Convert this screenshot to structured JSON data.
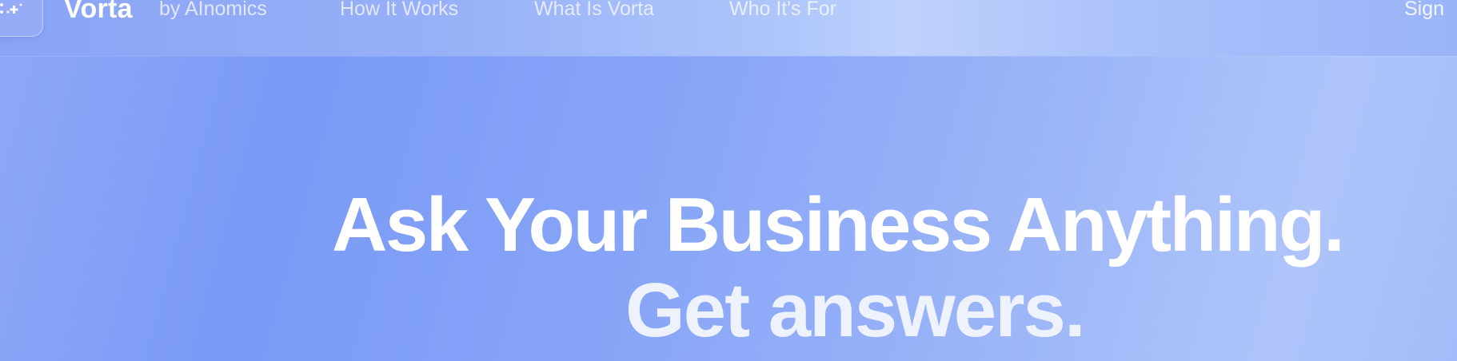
{
  "header": {
    "logo_icon": "sparkle-grid-icon",
    "brand": "Vorta",
    "byline": "by AInomics",
    "nav": [
      {
        "label": "How It Works"
      },
      {
        "label": "What Is Vorta"
      },
      {
        "label": "Who It's For"
      }
    ],
    "sign_in_label": "Sign"
  },
  "hero": {
    "headline": "Ask Your Business Anything.",
    "subheadline": "Get answers."
  },
  "colors": {
    "background_start": "#8fa9f7",
    "background_mid": "#7a9af6",
    "background_end": "#aec4fa",
    "headline_text": "#ffffff",
    "subheadline_text": "#eef2fd"
  }
}
